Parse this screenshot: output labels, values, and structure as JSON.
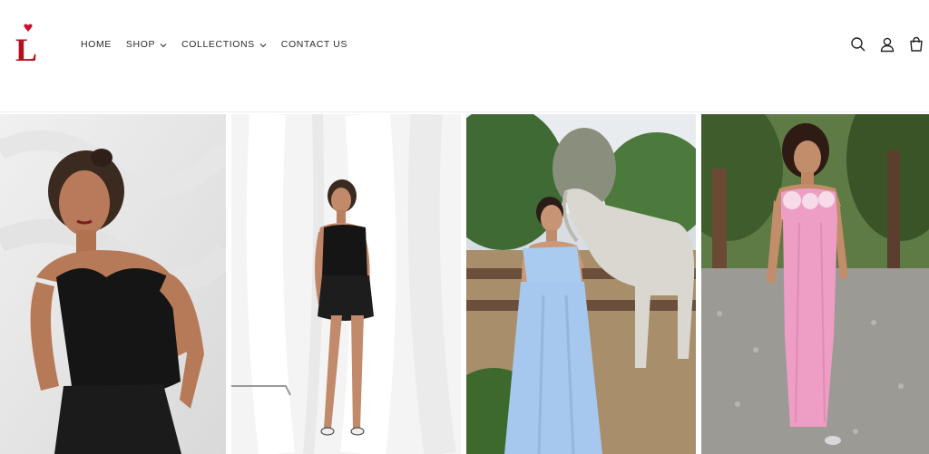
{
  "brand": {
    "logo_letter": "L",
    "accent_color": "#c8102e"
  },
  "nav": {
    "items": [
      {
        "label": "HOME",
        "has_dropdown": false
      },
      {
        "label": "SHOP",
        "has_dropdown": true
      },
      {
        "label": "COLLECTIONS",
        "has_dropdown": true
      },
      {
        "label": "CONTACT US",
        "has_dropdown": false
      }
    ]
  },
  "header_icons": [
    "search-icon",
    "account-icon",
    "cart-icon"
  ],
  "products": [
    {
      "image": "model-black-corset-top-white-backdrop",
      "dress_color": "#151515"
    },
    {
      "image": "model-black-corset-mini-dress-white-curtains",
      "dress_color": "#1a1a1a"
    },
    {
      "image": "model-blue-one-shoulder-gown-with-horse",
      "dress_color": "#a7c8ee"
    },
    {
      "image": "model-pink-strapless-gown-garden",
      "dress_color": "#ee9ec4"
    }
  ]
}
